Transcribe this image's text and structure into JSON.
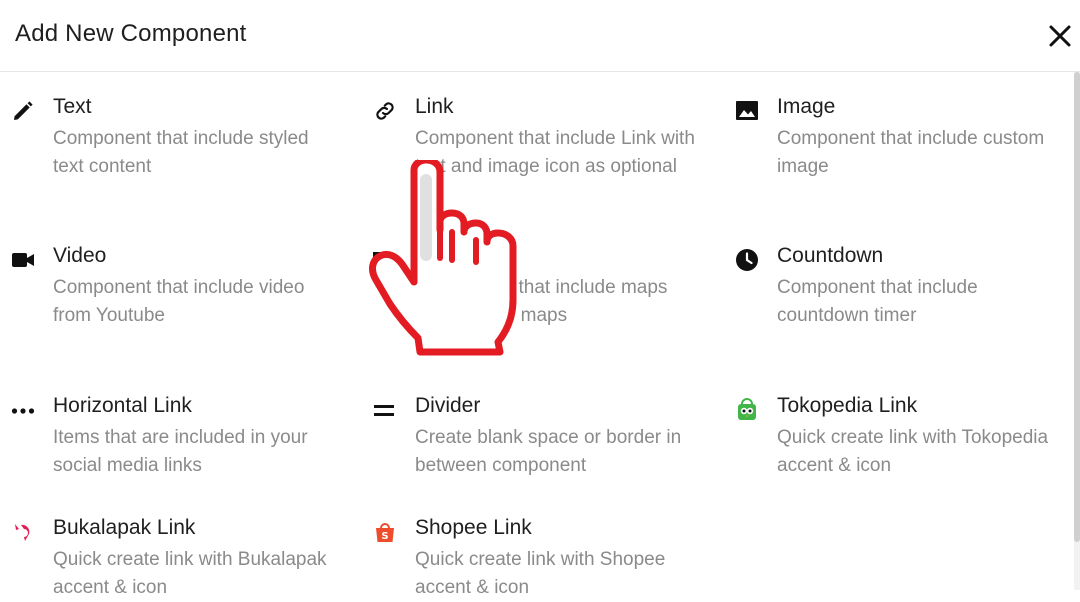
{
  "header": {
    "title": "Add New Component",
    "close_icon": "close-icon"
  },
  "components": [
    {
      "name": "Text",
      "desc": "Component that include styled text content",
      "icon": "pencil-icon"
    },
    {
      "name": "Link",
      "desc": "Component that include Link with text and image icon as optional",
      "icon": "link-icon"
    },
    {
      "name": "Image",
      "desc": "Component that include custom image",
      "icon": "image-icon"
    },
    {
      "name": "Video",
      "desc": "Component that include video from Youtube",
      "icon": "video-camera-icon"
    },
    {
      "name": "",
      "desc": "Component that include maps from google maps",
      "icon": "map-icon"
    },
    {
      "name": "Countdown",
      "desc": "Component that include countdown timer",
      "icon": "clock-icon"
    },
    {
      "name": "Horizontal Link",
      "desc": "Items that are included in your social media links",
      "icon": "more-horizontal-icon"
    },
    {
      "name": "Divider",
      "desc": "Create blank space or border in between component",
      "icon": "equals-icon"
    },
    {
      "name": "Tokopedia Link",
      "desc": "Quick create link with Tokopedia accent & icon",
      "icon": "tokopedia-icon"
    },
    {
      "name": "Bukalapak Link",
      "desc": "Quick create link with Bukalapak accent & icon",
      "icon": "bukalapak-icon"
    },
    {
      "name": "Shopee Link",
      "desc": "Quick create link with Shopee accent & icon",
      "icon": "shopee-icon"
    }
  ],
  "colors": {
    "text": "#1f1f1f",
    "muted": "#8a8a8a",
    "cursor_red": "#e31b23",
    "tokopedia_green": "#42b549",
    "bukalapak_red": "#e31e52",
    "shopee_orange": "#ee4d2d"
  }
}
